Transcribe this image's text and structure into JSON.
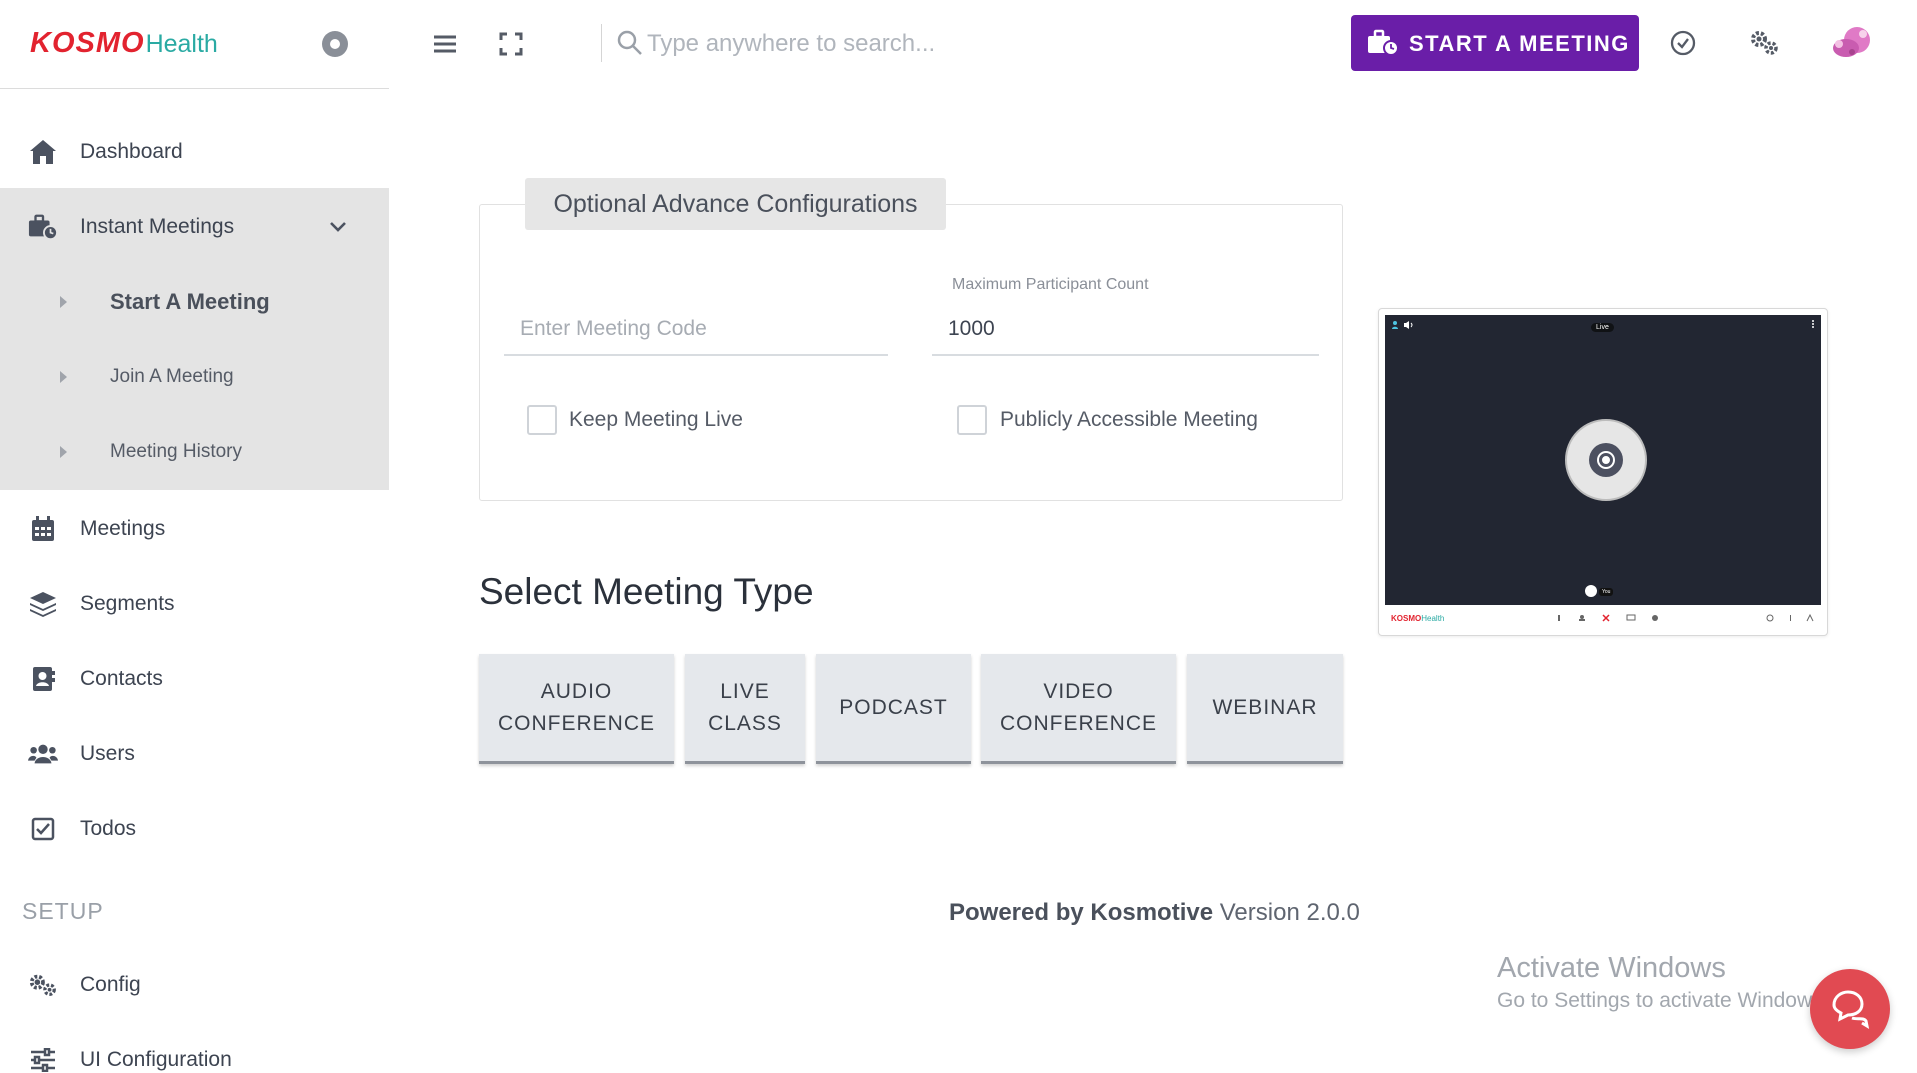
{
  "brand": {
    "logo_primary": "KOSMO",
    "logo_secondary": "Health",
    "primary_color": "#e2232f",
    "secondary_color": "#2aaaa3"
  },
  "header": {
    "search_placeholder": "Type anywhere to search...",
    "start_meeting_label": "START A MEETING",
    "accent_color": "#6a1ea8",
    "icons": [
      "hamburger-icon",
      "fullscreen-icon",
      "search-icon",
      "briefcase-clock-icon",
      "check-circle-icon",
      "gears-icon",
      "avatar"
    ]
  },
  "sidebar": {
    "items": [
      {
        "label": "Dashboard",
        "icon": "home-icon"
      },
      {
        "label": "Instant Meetings",
        "icon": "briefcase-clock-icon",
        "expanded": true,
        "children": [
          {
            "label": "Start A Meeting",
            "active": true
          },
          {
            "label": "Join A Meeting"
          },
          {
            "label": "Meeting History"
          }
        ]
      },
      {
        "label": "Meetings",
        "icon": "calendar-icon"
      },
      {
        "label": "Segments",
        "icon": "layers-icon"
      },
      {
        "label": "Contacts",
        "icon": "address-book-icon"
      },
      {
        "label": "Users",
        "icon": "users-icon"
      },
      {
        "label": "Todos",
        "icon": "checkbox-icon"
      }
    ],
    "setup_heading": "SETUP",
    "setup_items": [
      {
        "label": "Config",
        "icon": "gears-icon"
      },
      {
        "label": "UI Configuration",
        "icon": "sliders-icon"
      }
    ]
  },
  "config": {
    "title": "Optional Advance Configurations",
    "meeting_code_placeholder": "Enter Meeting Code",
    "meeting_code_value": "",
    "max_participants_label": "Maximum Participant Count",
    "max_participants_value": "1000",
    "keep_live_label": "Keep Meeting Live",
    "keep_live_checked": false,
    "public_label": "Publicly Accessible Meeting",
    "public_checked": false
  },
  "meeting_types": {
    "title": "Select Meeting Type",
    "options": [
      "AUDIO\nCONFERENCE",
      "LIVE\nCLASS",
      "PODCAST",
      "VIDEO\nCONFERENCE",
      "WEBINAR"
    ]
  },
  "preview": {
    "live_label": "Live",
    "you_label": "You",
    "logo_primary": "KOSMO",
    "logo_secondary": "Health"
  },
  "footer": {
    "powered_prefix": "Powered by Kosmotive",
    "version": "Version 2.0.0"
  },
  "watermark": {
    "title": "Activate Windows",
    "subtitle": "Go to Settings to activate Windows."
  },
  "chat": {
    "icon": "chat-bubbles-icon",
    "color": "#e14a52"
  }
}
